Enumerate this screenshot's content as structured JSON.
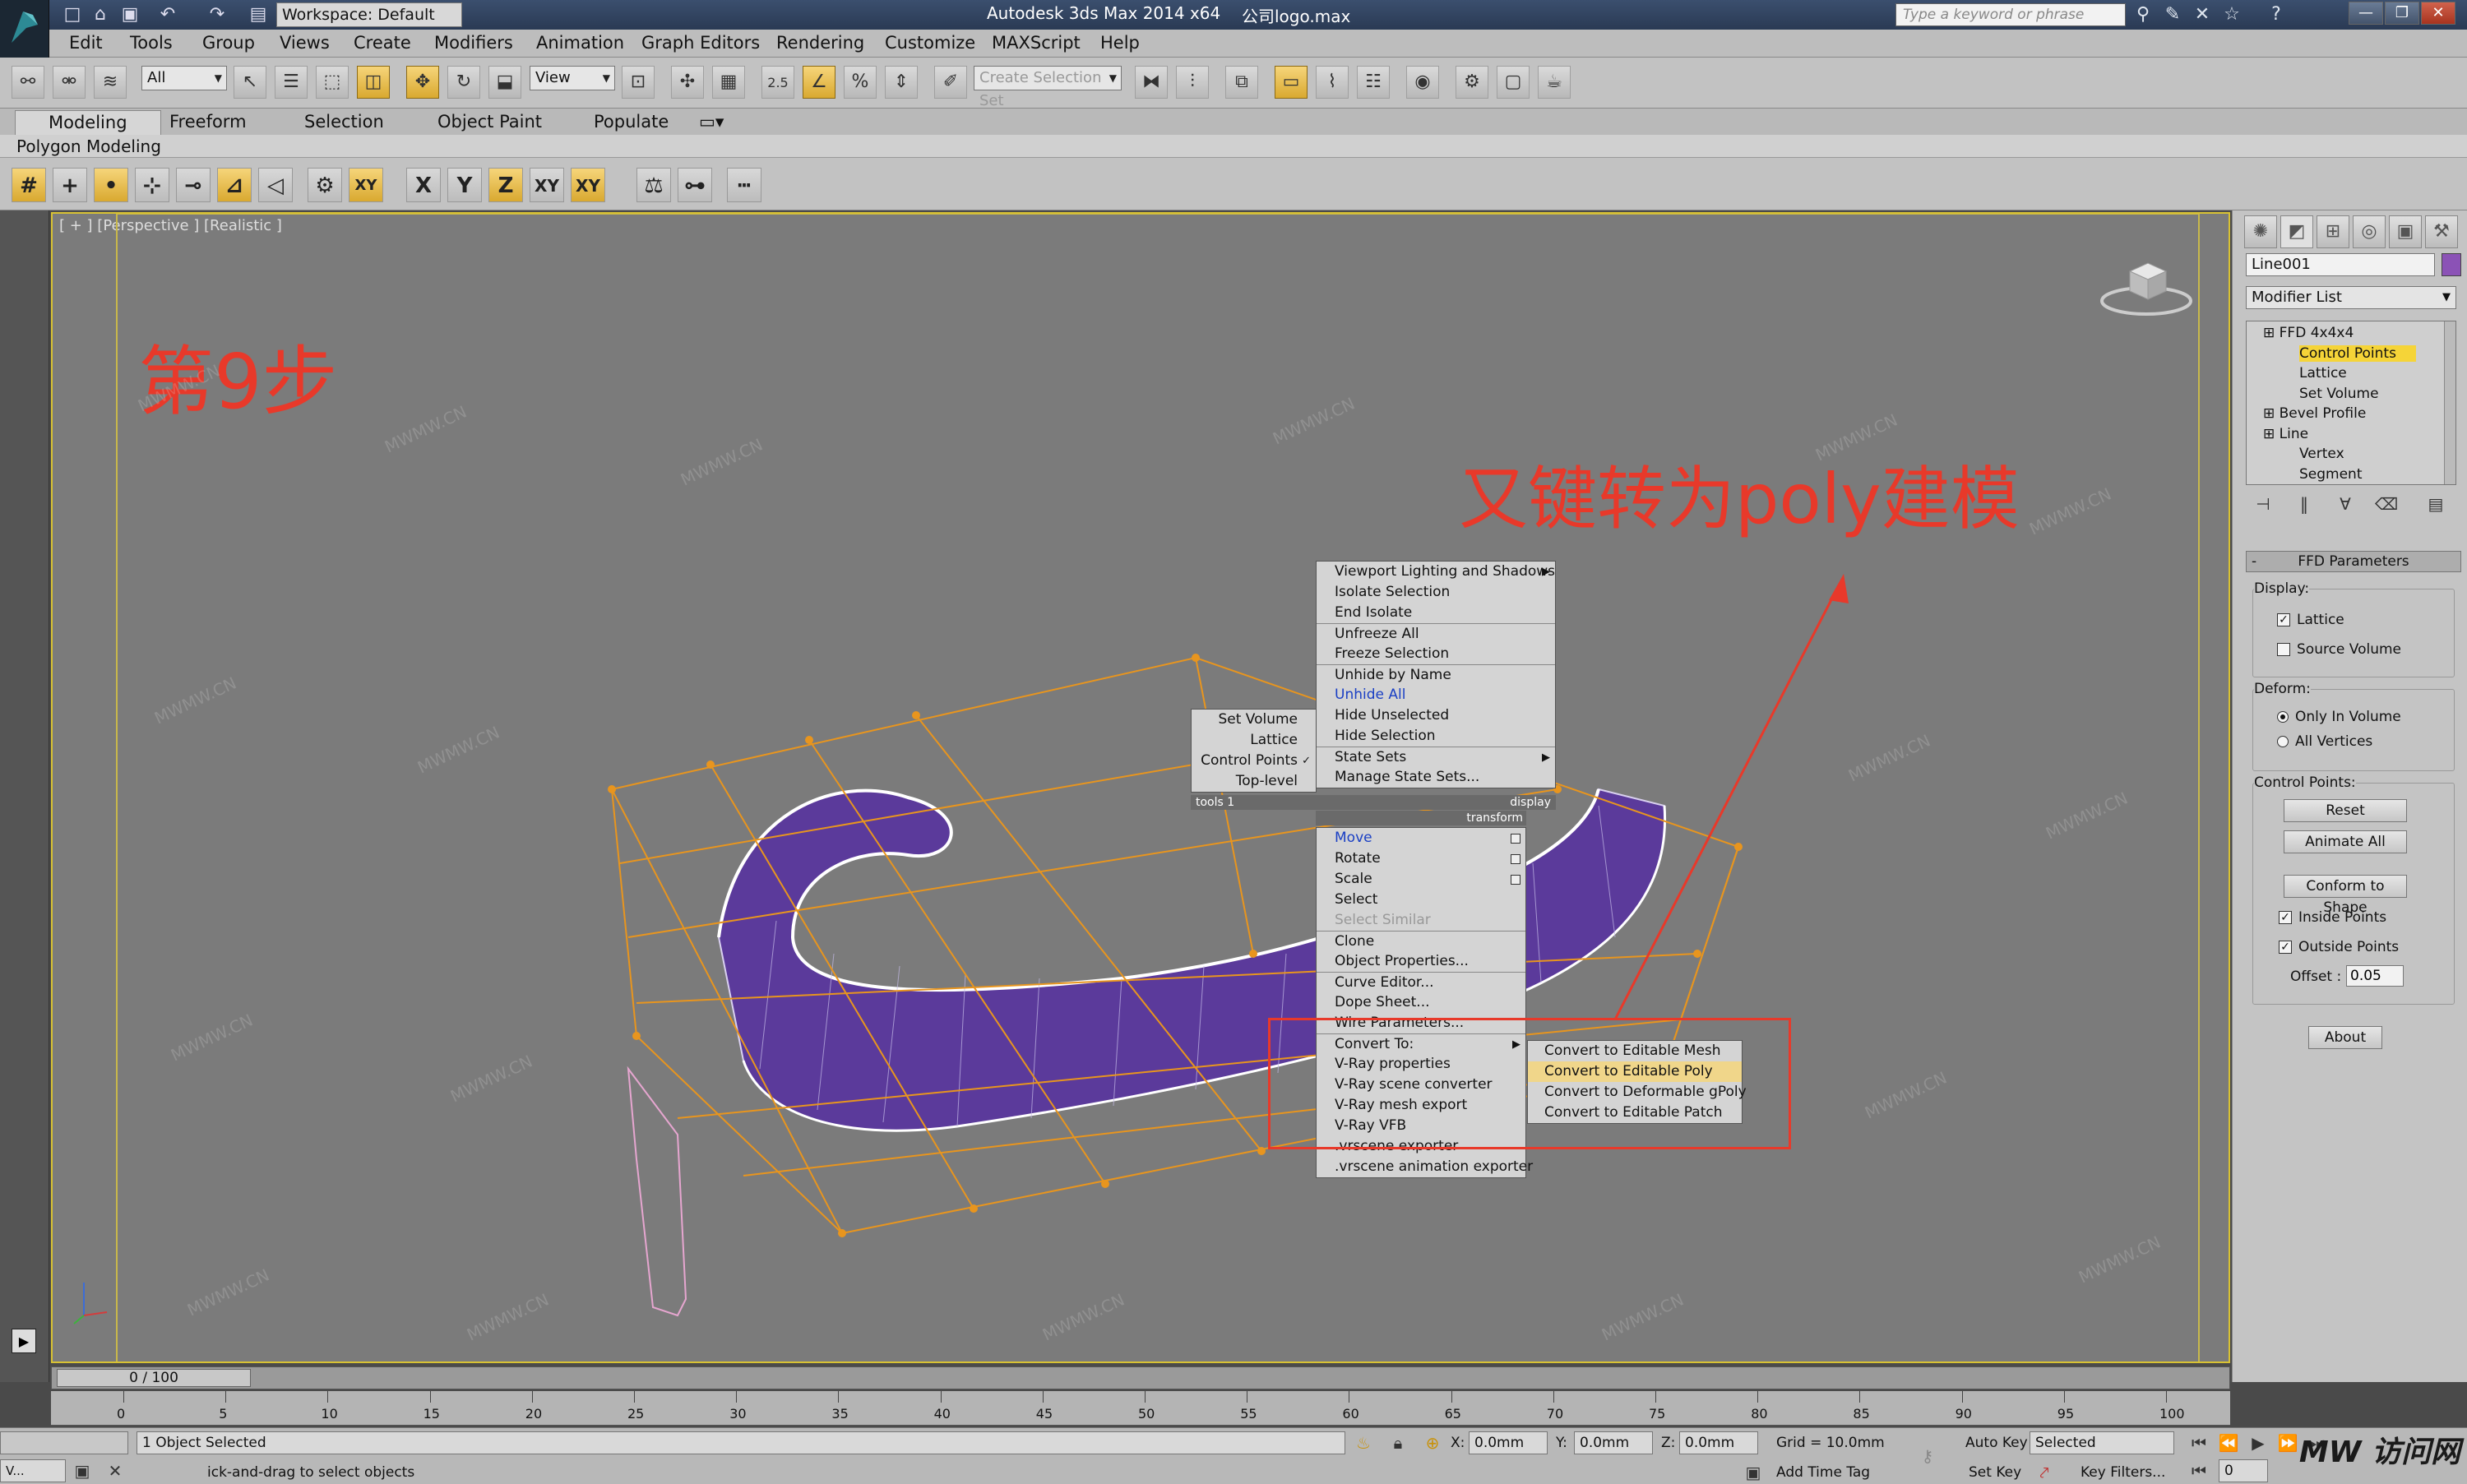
{
  "title_bar": {
    "workspace_label": "Workspace: Default",
    "app_title": "Autodesk 3ds Max  2014 x64",
    "file_name": "公司logo.max",
    "search_placeholder": "Type a keyword or phrase"
  },
  "menu": [
    "Edit",
    "Tools",
    "Group",
    "Views",
    "Create",
    "Modifiers",
    "Animation",
    "Graph Editors",
    "Rendering",
    "Customize",
    "MAXScript",
    "Help"
  ],
  "toolbar": {
    "filter": "All",
    "ref_coord": "View",
    "snap_value": "2.5",
    "selection_set_placeholder": "Create Selection Set"
  },
  "ribbon": {
    "tabs": [
      "Modeling",
      "Freeform",
      "Selection",
      "Object Paint",
      "Populate"
    ],
    "sub_label": "Polygon Modeling"
  },
  "axis_buttons": [
    "X",
    "Y",
    "Z",
    "XY",
    "XY"
  ],
  "viewport": {
    "label": "[ + ] [Perspective ] [Realistic ]",
    "step_note": "第9步",
    "annotation": "又键转为poly建模",
    "watermark": "MWMW.CN"
  },
  "quad_menu": {
    "display": [
      {
        "label": "Viewport Lighting and Shadows",
        "submenu": true
      },
      {
        "label": "Isolate Selection"
      },
      {
        "label": "End Isolate"
      },
      {
        "label": "Unfreeze All",
        "sep": true
      },
      {
        "label": "Freeze Selection"
      },
      {
        "label": "Unhide by Name",
        "sep": true
      },
      {
        "label": "Unhide All",
        "blue": true
      },
      {
        "label": "Hide Unselected"
      },
      {
        "label": "Hide Selection"
      },
      {
        "label": "State Sets",
        "submenu": true,
        "sep": true
      },
      {
        "label": "Manage State Sets..."
      }
    ],
    "tools1": [
      {
        "label": "Set Volume"
      },
      {
        "label": "Lattice"
      },
      {
        "label": "Control Points",
        "checked": true
      },
      {
        "label": "Top-level"
      }
    ],
    "header_tools": "tools 1",
    "header_display": "display",
    "header_transform": "transform",
    "transform": [
      {
        "label": "Move",
        "blue": true,
        "box": true
      },
      {
        "label": "Rotate",
        "box": true
      },
      {
        "label": "Scale",
        "box": true
      },
      {
        "label": "Select"
      },
      {
        "label": "Select Similar",
        "dim": true
      },
      {
        "label": "Clone",
        "sep": true
      },
      {
        "label": "Object Properties..."
      },
      {
        "label": "Curve Editor...",
        "sep": true
      },
      {
        "label": "Dope Sheet..."
      },
      {
        "label": "Wire Parameters..."
      },
      {
        "label": "Convert To:",
        "submenu": true,
        "sep": true
      },
      {
        "label": "V-Ray properties"
      },
      {
        "label": "V-Ray scene converter"
      },
      {
        "label": "V-Ray mesh export"
      },
      {
        "label": "V-Ray VFB"
      },
      {
        "label": ".vrscene exporter"
      },
      {
        "label": ".vrscene animation exporter"
      }
    ],
    "convert_submenu": [
      {
        "label": "Convert to Editable Mesh"
      },
      {
        "label": "Convert to Editable Poly",
        "highlight": true
      },
      {
        "label": "Convert to Deformable gPoly"
      },
      {
        "label": "Convert to Editable Patch"
      }
    ]
  },
  "command_panel": {
    "object_name": "Line001",
    "modifier_list": "Modifier List",
    "stack": [
      {
        "label": "FFD 4x4x4",
        "level": 0
      },
      {
        "label": "Control Points",
        "level": 1,
        "selected": true
      },
      {
        "label": "Lattice",
        "level": 1
      },
      {
        "label": "Set Volume",
        "level": 1
      },
      {
        "label": "Bevel Profile",
        "level": 0
      },
      {
        "label": "Line",
        "level": 0
      },
      {
        "label": "Vertex",
        "level": 1
      },
      {
        "label": "Segment",
        "level": 1
      }
    ],
    "rollout_title": "FFD Parameters",
    "display_group": "Display:",
    "lattice": "Lattice",
    "source_volume": "Source Volume",
    "deform_group": "Deform:",
    "only_in_volume": "Only In Volume",
    "all_vertices": "All Vertices",
    "control_points_group": "Control Points:",
    "reset": "Reset",
    "animate_all": "Animate All",
    "conform": "Conform to Shape",
    "inside_points": "Inside Points",
    "outside_points": "Outside Points",
    "offset_label": "Offset :",
    "offset_value": "0.05",
    "about": "About"
  },
  "timeline": {
    "frame_label": "0 / 100",
    "ticks": [
      "0",
      "5",
      "10",
      "15",
      "20",
      "25",
      "30",
      "35",
      "40",
      "45",
      "50",
      "55",
      "60",
      "65",
      "70",
      "75",
      "80",
      "85",
      "90",
      "95",
      "100"
    ]
  },
  "status": {
    "selected": "1 Object Selected",
    "prompt": "ick-and-drag to select objects",
    "x_label": "X:",
    "x_val": "0.0mm",
    "y_label": "Y:",
    "y_val": "0.0mm",
    "z_label": "Z:",
    "z_val": "0.0mm",
    "grid": "Grid = 10.0mm",
    "add_time_tag": "Add Time Tag",
    "auto_key": "Auto Key",
    "set_key": "Set Key",
    "selected_dropdown": "Selected",
    "key_filters": "Key Filters...",
    "frame_field": "0",
    "taskbar_label": "V...",
    "brand": "MW 访问网"
  }
}
